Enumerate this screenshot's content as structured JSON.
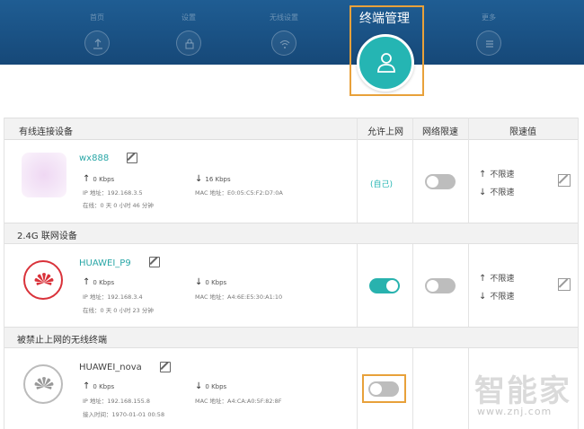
{
  "header": {
    "nav_items": [
      {
        "label": "首页",
        "icon": "upload-icon"
      },
      {
        "label": "设置",
        "icon": "lock-icon"
      },
      {
        "label": "无线设置",
        "icon": "wifi-icon"
      },
      {
        "label": "终端管理",
        "icon": "user-icon",
        "active": true
      },
      {
        "label": "更多",
        "icon": "menu-icon"
      }
    ],
    "active_color": "#25b5b3",
    "bar_color": "#1f5d93"
  },
  "table": {
    "columns": [
      "有线连接设备",
      "允许上网",
      "网络限速",
      "限速值"
    ],
    "sections": [
      {
        "title": "有线连接设备",
        "devices": [
          {
            "name": "wx888",
            "up": "0 Kbps",
            "down": "16 Kbps",
            "ip": "IP 地址：192.168.3.5",
            "mac": "MAC 地址：E0:05:C5:F2:D7:0A",
            "time": "在线：0 天 0 小时 46 分钟",
            "allow": "(自己)",
            "speed_limit": "off",
            "limit_up": "不限速",
            "limit_down": "不限速"
          }
        ]
      },
      {
        "title": "2.4G 联网设备",
        "devices": [
          {
            "name": "HUAWEI_P9",
            "up": "0 Kbps",
            "down": "0 Kbps",
            "ip": "IP 地址：192.168.3.4",
            "mac": "MAC 地址：A4:6E:E5:30:A1:10",
            "time": "在线：0 天 0 小时 23 分钟",
            "allow": "on",
            "speed_limit": "off",
            "limit_up": "不限速",
            "limit_down": "不限速"
          }
        ]
      },
      {
        "title": "被禁止上网的无线终端",
        "devices": [
          {
            "name": "HUAWEI_nova",
            "up": "0 Kbps",
            "down": "0 Kbps",
            "ip": "IP 地址：192.168.155.8",
            "mac": "MAC 地址：A4:CA:A0:5F:82:8F",
            "time": "接入时间：1970-01-01 00:58",
            "allow": "off"
          }
        ]
      }
    ]
  },
  "watermark": {
    "text": "智能家",
    "url": "www.znj.com"
  }
}
